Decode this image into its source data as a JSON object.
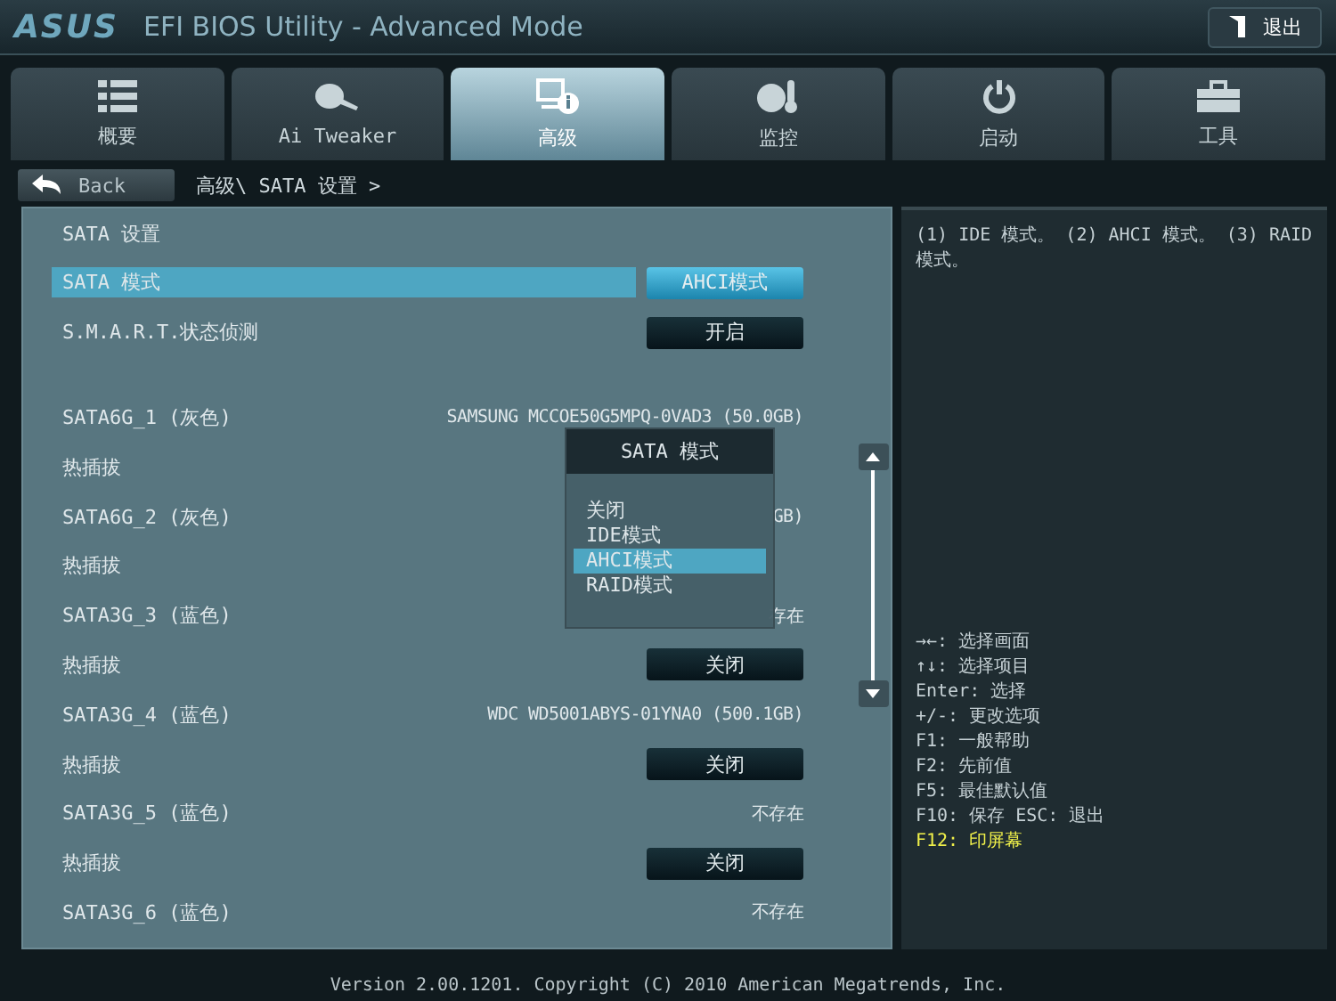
{
  "header": {
    "brand": "ASUS",
    "title": "EFI BIOS Utility - Advanced Mode",
    "exit_label": "退出"
  },
  "tabs": [
    {
      "label": "概要",
      "selected": false
    },
    {
      "label": "Ai Tweaker",
      "selected": false
    },
    {
      "label": "高级",
      "selected": true
    },
    {
      "label": "监控",
      "selected": false
    },
    {
      "label": "启动",
      "selected": false
    },
    {
      "label": "工具",
      "selected": false
    }
  ],
  "back_button": "Back",
  "breadcrumb": "高级\\ SATA 设置 >",
  "section_title": "SATA 设置",
  "rows": [
    {
      "kind": "setting",
      "label": "SATA 模式",
      "value": "AHCI模式",
      "selected": true
    },
    {
      "kind": "setting",
      "label": "S.M.A.R.T.状态侦测",
      "value": "开启",
      "selected": false
    },
    {
      "kind": "gap"
    },
    {
      "kind": "info",
      "label": "SATA6G_1 (灰色)",
      "value": "SAMSUNG MCCOE50G5MPQ-0VAD3 (50.0GB)"
    },
    {
      "kind": "setting",
      "label": "热插拔",
      "selected": false
    },
    {
      "kind": "info",
      "label": "SATA6G_2 (灰色)",
      "value": "GB)"
    },
    {
      "kind": "setting",
      "label": "热插拔",
      "selected": false
    },
    {
      "kind": "info",
      "label": "SATA3G_3 (蓝色)",
      "value": "存在"
    },
    {
      "kind": "setting",
      "label": "热插拔",
      "value": "关闭",
      "selected": false
    },
    {
      "kind": "info",
      "label": "SATA3G_4 (蓝色)",
      "value": "WDC WD5001ABYS-01YNA0 (500.1GB)"
    },
    {
      "kind": "setting",
      "label": "热插拔",
      "value": "关闭",
      "selected": false
    },
    {
      "kind": "info",
      "label": "SATA3G_5 (蓝色)",
      "value": "不存在"
    },
    {
      "kind": "setting",
      "label": "热插拔",
      "value": "关闭",
      "selected": false
    },
    {
      "kind": "info",
      "label": "SATA3G_6 (蓝色)",
      "value": "不存在"
    }
  ],
  "popup": {
    "title": "SATA 模式",
    "options": [
      {
        "label": "关闭",
        "selected": false
      },
      {
        "label": "IDE模式",
        "selected": false
      },
      {
        "label": "AHCI模式",
        "selected": true
      },
      {
        "label": "RAID模式",
        "selected": false
      }
    ]
  },
  "help_text": "(1) IDE 模式。 (2) AHCI 模式。 (3) RAID 模式。",
  "key_hints": [
    {
      "text": "→←: 选择画面",
      "highlighted": false
    },
    {
      "text": "↑↓: 选择项目",
      "highlighted": false
    },
    {
      "text": "Enter: 选择",
      "highlighted": false
    },
    {
      "text": "+/-: 更改选项",
      "highlighted": false
    },
    {
      "text": "F1: 一般帮助",
      "highlighted": false
    },
    {
      "text": "F2: 先前值",
      "highlighted": false
    },
    {
      "text": "F5: 最佳默认值",
      "highlighted": false
    },
    {
      "text": "F10: 保存  ESC: 退出",
      "highlighted": false
    },
    {
      "text": "F12: 印屏幕",
      "highlighted": true
    }
  ],
  "footer": "Version 2.00.1201. Copyright (C) 2010 American Megatrends, Inc."
}
